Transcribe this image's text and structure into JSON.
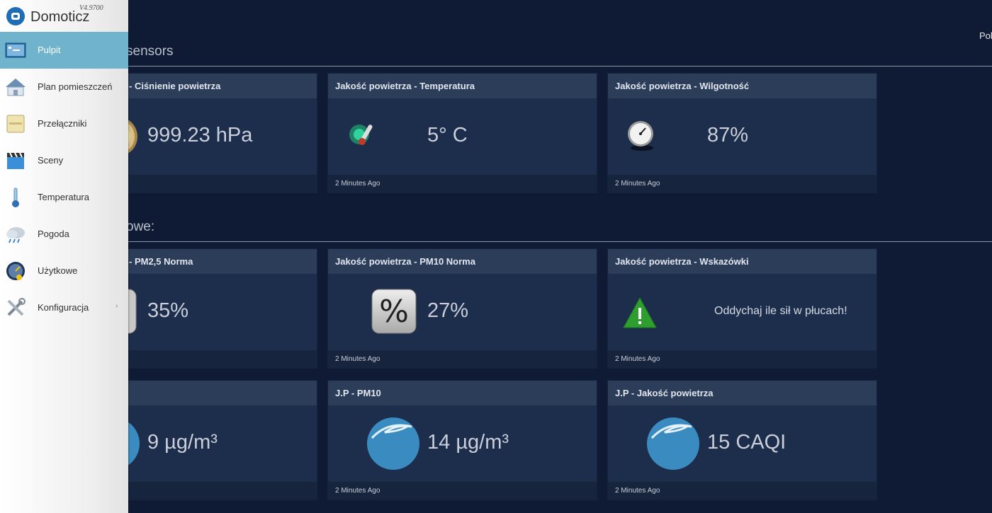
{
  "header": {
    "top_right_text": "Pol"
  },
  "sections": [
    {
      "title": "sensors"
    },
    {
      "title": "owe:"
    }
  ],
  "cards": [
    {
      "title": "- Ciśnienie powietrza",
      "value": "999.23 hPa",
      "footer": "",
      "icon": "barometer-icon"
    },
    {
      "title": "Jakość powietrza - Temperatura",
      "value": "5° C",
      "footer": "2 Minutes Ago",
      "icon": "thermometer-icon"
    },
    {
      "title": "Jakość powietrza - Wilgotność",
      "value": "87%",
      "footer": "2 Minutes Ago",
      "icon": "gauge-icon"
    },
    {
      "title": "- PM2,5 Norma",
      "value": "35%",
      "footer": "",
      "icon": "percent-icon"
    },
    {
      "title": "Jakość powietrza - PM10 Norma",
      "value": "27%",
      "footer": "2 Minutes Ago",
      "icon": "percent-icon"
    },
    {
      "title": "Jakość powietrza - Wskazówki",
      "value": "Oddychaj ile sił w płucach!",
      "footer": "2 Minutes Ago",
      "icon": "warning-icon"
    },
    {
      "title": "",
      "value": "9 µg/m³",
      "footer": "",
      "icon": "air-icon"
    },
    {
      "title": "J.P - PM10",
      "value": "14 µg/m³",
      "footer": "2 Minutes Ago",
      "icon": "air-icon"
    },
    {
      "title": "J.P - Jakość powietrza",
      "value": "15 CAQI",
      "footer": "2 Minutes Ago",
      "icon": "air-icon"
    }
  ],
  "sidebar": {
    "brand": "Domoticz",
    "version": "V4.9700",
    "items": [
      {
        "label": "Pulpit",
        "icon": "dashboard-icon",
        "active": true
      },
      {
        "label": "Plan pomieszczeń",
        "icon": "house-icon"
      },
      {
        "label": "Przełączniki",
        "icon": "switch-icon"
      },
      {
        "label": "Sceny",
        "icon": "clapperboard-icon"
      },
      {
        "label": "Temperatura",
        "icon": "thermometer-icon"
      },
      {
        "label": "Pogoda",
        "icon": "weather-cloud-icon"
      },
      {
        "label": "Użytkowe",
        "icon": "utility-gauge-icon"
      },
      {
        "label": "Konfiguracja",
        "icon": "tools-icon",
        "has_submenu": true
      }
    ]
  }
}
